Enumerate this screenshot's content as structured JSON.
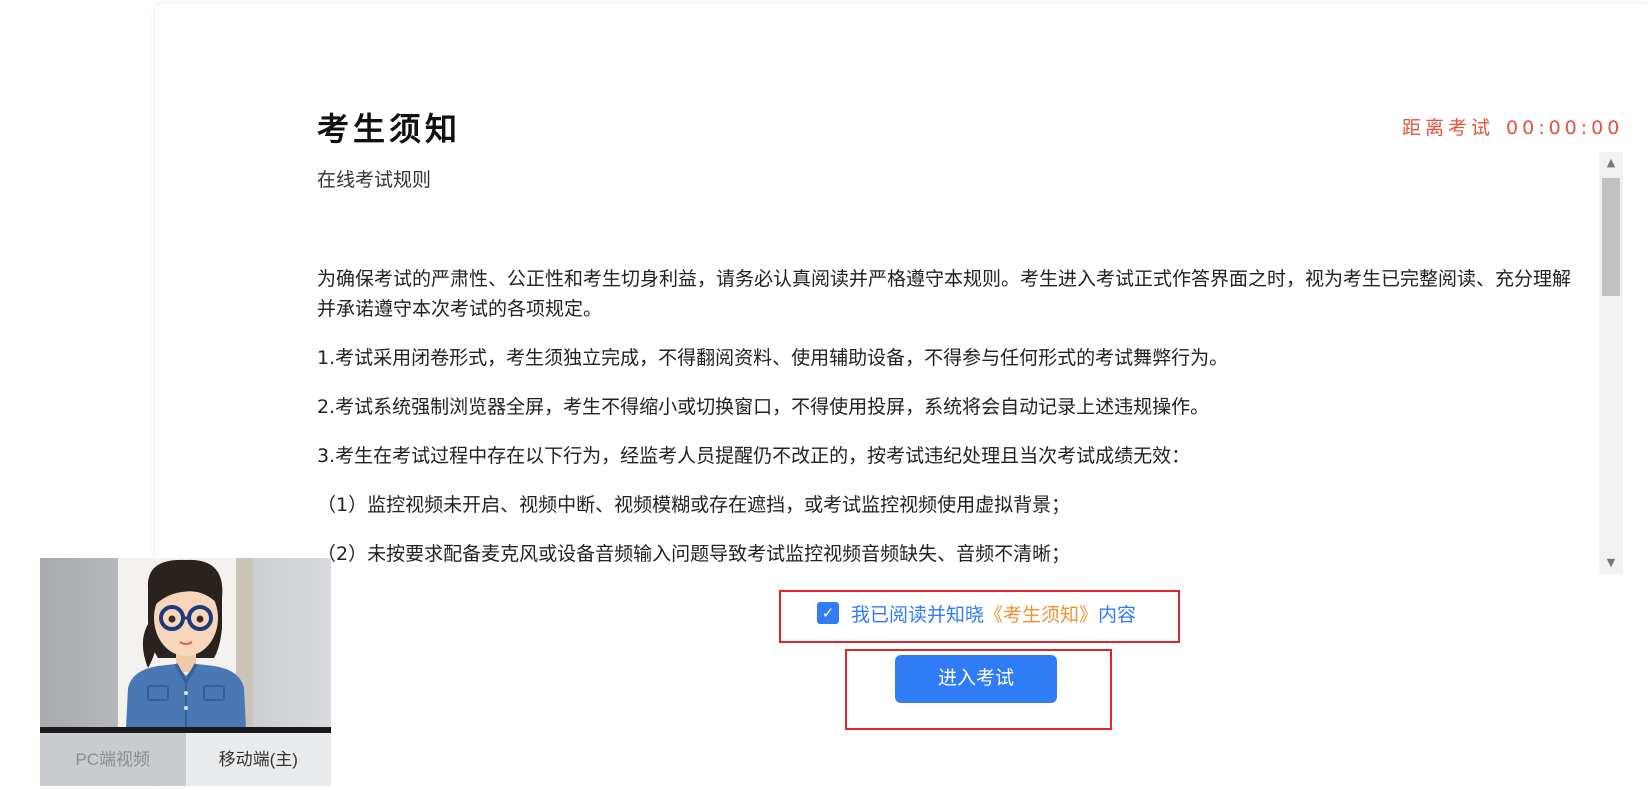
{
  "header": {
    "title": "考生须知",
    "subtitle": "在线考试规则",
    "countdown_label": "距离考试",
    "countdown_time": "00:00:00"
  },
  "rules": {
    "paragraphs": [
      "为确保考试的严肃性、公正性和考生切身利益，请务必认真阅读并严格遵守本规则。考生进入考试正式作答界面之时，视为考生已完整阅读、充分理解并承诺遵守本次考试的各项规定。",
      "1.考试采用闭卷形式，考生须独立完成，不得翻阅资料、使用辅助设备，不得参与任何形式的考试舞弊行为。",
      "2.考试系统强制浏览器全屏，考生不得缩小或切换窗口，不得使用投屏，系统将会自动记录上述违规操作。",
      "3.考生在考试过程中存在以下行为，经监考人员提醒仍不改正的，按考试违纪处理且当次考试成绩无效：",
      "（1）监控视频未开启、视频中断、视频模糊或存在遮挡，或考试监控视频使用虚拟背景；",
      "（2）未按要求配备麦克风或设备音频输入问题导致考试监控视频音频缺失、音频不清晰；"
    ]
  },
  "acknowledge": {
    "checked": true,
    "text_prefix": "我已阅读并知晓",
    "link_text": "《考生须知》",
    "text_suffix": "内容"
  },
  "actions": {
    "enter_label": "进入考试"
  },
  "video": {
    "tab_pc": "PC端视频",
    "tab_mobile": "移动端(主)"
  },
  "colors": {
    "primary": "#2f7cf6",
    "countdown": "#e2553c",
    "link": "#f0922d",
    "highlight_border": "#e0262c"
  },
  "icons": {
    "checkbox": "check-icon",
    "scroll_up": "scroll-up-arrow-icon",
    "scroll_down": "scroll-down-arrow-icon"
  }
}
